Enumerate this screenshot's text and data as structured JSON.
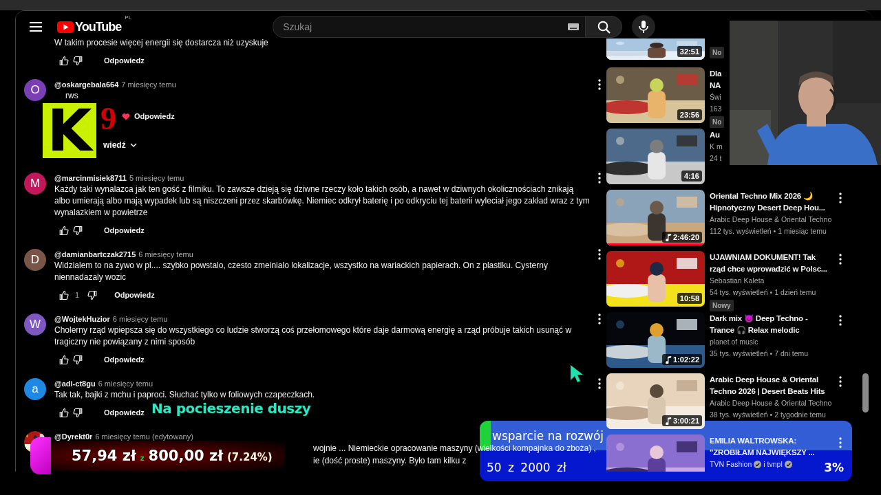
{
  "header": {
    "logo_text": "YouTube",
    "region": "PL",
    "search": {
      "placeholder": "Szukaj"
    }
  },
  "comments": [
    {
      "kind": "continued",
      "text": "W takim procesie więcej energii się dostarcza niż uzyskuje",
      "reply_label": "Odpowiedz"
    },
    {
      "kind": "covered",
      "author": "@oskargebala664",
      "time": "7 miesięcy temu",
      "avatar": "O",
      "color": "#7b3fb5",
      "text": "rws",
      "reply_label": "Odpowiedz",
      "hearted": true,
      "replies_label": "wiedź"
    },
    {
      "kind": "full",
      "author": "@marcinmisiek8711",
      "time": "5 miesięcy temu",
      "avatar": "M",
      "color": "#c2185b",
      "text": "Każdy taki wynalazca jak ten gość z filmiku. To zawsze dzieją się dziwne rzeczy koło takich osób, a nawet w dziwnych okolicznościach znikają albo umierają albo mają wypadek lub są niszczeni przez skarbówkę. Niemiec odkrył baterię i po odkryciu tej baterii wyleciał jego zakład wraz z tym wynalazkiem w powietrze",
      "reply_label": "Odpowiedz"
    },
    {
      "kind": "full",
      "author": "@damianbartczak2715",
      "time": "6 miesięcy temu",
      "avatar": "D",
      "color": "#795548",
      "text": "Widzialem to na zywo w pl.... szybko powstalo, czesto zmeinialo lokalizacje, wszystko na wariackich papierach. On z plastiku. Cysterny niennadazaly wozic",
      "likes": "1",
      "reply_label": "Odpowiedz"
    },
    {
      "kind": "full",
      "author": "@WojtekHuzior",
      "time": "6 miesięcy temu",
      "avatar": "W",
      "color": "#7e57c2",
      "text": "Cholerny rząd wpiepsza się do wszystkiego co ludzie stworzą coś przełomowego które daje darmową energię a rząd próbuje takich usunąć w tragiczny nie powiązany z nimi sposób",
      "reply_label": "Odpowiedz"
    },
    {
      "kind": "full",
      "author": "@adi-ct8gu",
      "time": "6 miesięcy temu",
      "avatar": "a",
      "color": "#1e88e5",
      "text": "Tak tak, bajki z mchu i paproci. Słuchać tylko w foliowych czapeczkach.",
      "reply_label": "Odpowiedz"
    },
    {
      "kind": "partial",
      "author": "@Dyrekt0r",
      "time": "6 miesięcy temu (edytowany)",
      "lines": [
        "wojnie ... Niemieckie opracowanie maszyny (wielkości kompajnka do zboża) ,",
        "ie (dość proste) maszyny. Było tam kilku z"
      ]
    }
  ],
  "videos": [
    {
      "kind": "cut",
      "duration": "32:51",
      "badge": "No"
    },
    {
      "kind": "normal",
      "title_lines": [
        "Dla",
        "NA"
      ],
      "channel": "Świ",
      "meta": "163",
      "duration": "23:56",
      "badge": "No"
    },
    {
      "kind": "normal",
      "title_lines": [
        "Au"
      ],
      "channel": "K m",
      "meta": "24 t",
      "duration": "4:16"
    },
    {
      "kind": "normal",
      "title_lines": [
        "Oriental Techno Mix 2026 🌙",
        "Hipnotyczny Desert Deep Hou..."
      ],
      "channel": "Arabic Deep House & Oriental Techno",
      "meta": "112 tys. wyświetleń • 1 miesiąc temu",
      "duration": "2:46:20",
      "music": true,
      "level": 1
    },
    {
      "kind": "normal",
      "title_lines": [
        "UJAWNIAM DOKUMENT! Tak",
        "rząd chce wprowadzić w Polsc..."
      ],
      "channel": "Sebastian Kaleta",
      "meta": "54 tys. wyświetleń • 1 dzień temu",
      "duration": "10:58",
      "badge": "Nowy"
    },
    {
      "kind": "normal",
      "title_lines": [
        "Dark mix 👿 Deep Techno -",
        "Trance 🎧 Relax melodic"
      ],
      "channel": "planet of music",
      "meta": "35 tys. wyświetleń • 7 dni temu",
      "duration": "1:02:22",
      "music": true
    },
    {
      "kind": "normal",
      "title_lines": [
        "Arabic Deep House & Oriental",
        "Techno 2026 | Desert Beats Hits"
      ],
      "channel": "Arabic Deep House & Oriental Techno",
      "meta": "38 tys. wyświetleń • 2 tygodnie temu",
      "duration": "3:00:21",
      "music": true
    },
    {
      "kind": "verified",
      "title_lines": [
        "EMILIA WALTROWSKA:",
        "\"ZROBIŁAM NAJWIĘKSZY ..."
      ],
      "channel_parts": [
        "TVN Fashion",
        "i tvnpl"
      ]
    }
  ],
  "overlays": {
    "stream_logo": {
      "letter": "K",
      "digit": "9"
    },
    "caption": "Na pocieszenie duszy",
    "donation": {
      "raised": "57,94 zł",
      "separator": "z",
      "target": "800,00 zł",
      "percent": "(7.24%)"
    },
    "goal": {
      "title": "wsparcie na rozwój",
      "amount": "50 z 2000 zł",
      "percent": "3%",
      "level": 0.03
    }
  }
}
